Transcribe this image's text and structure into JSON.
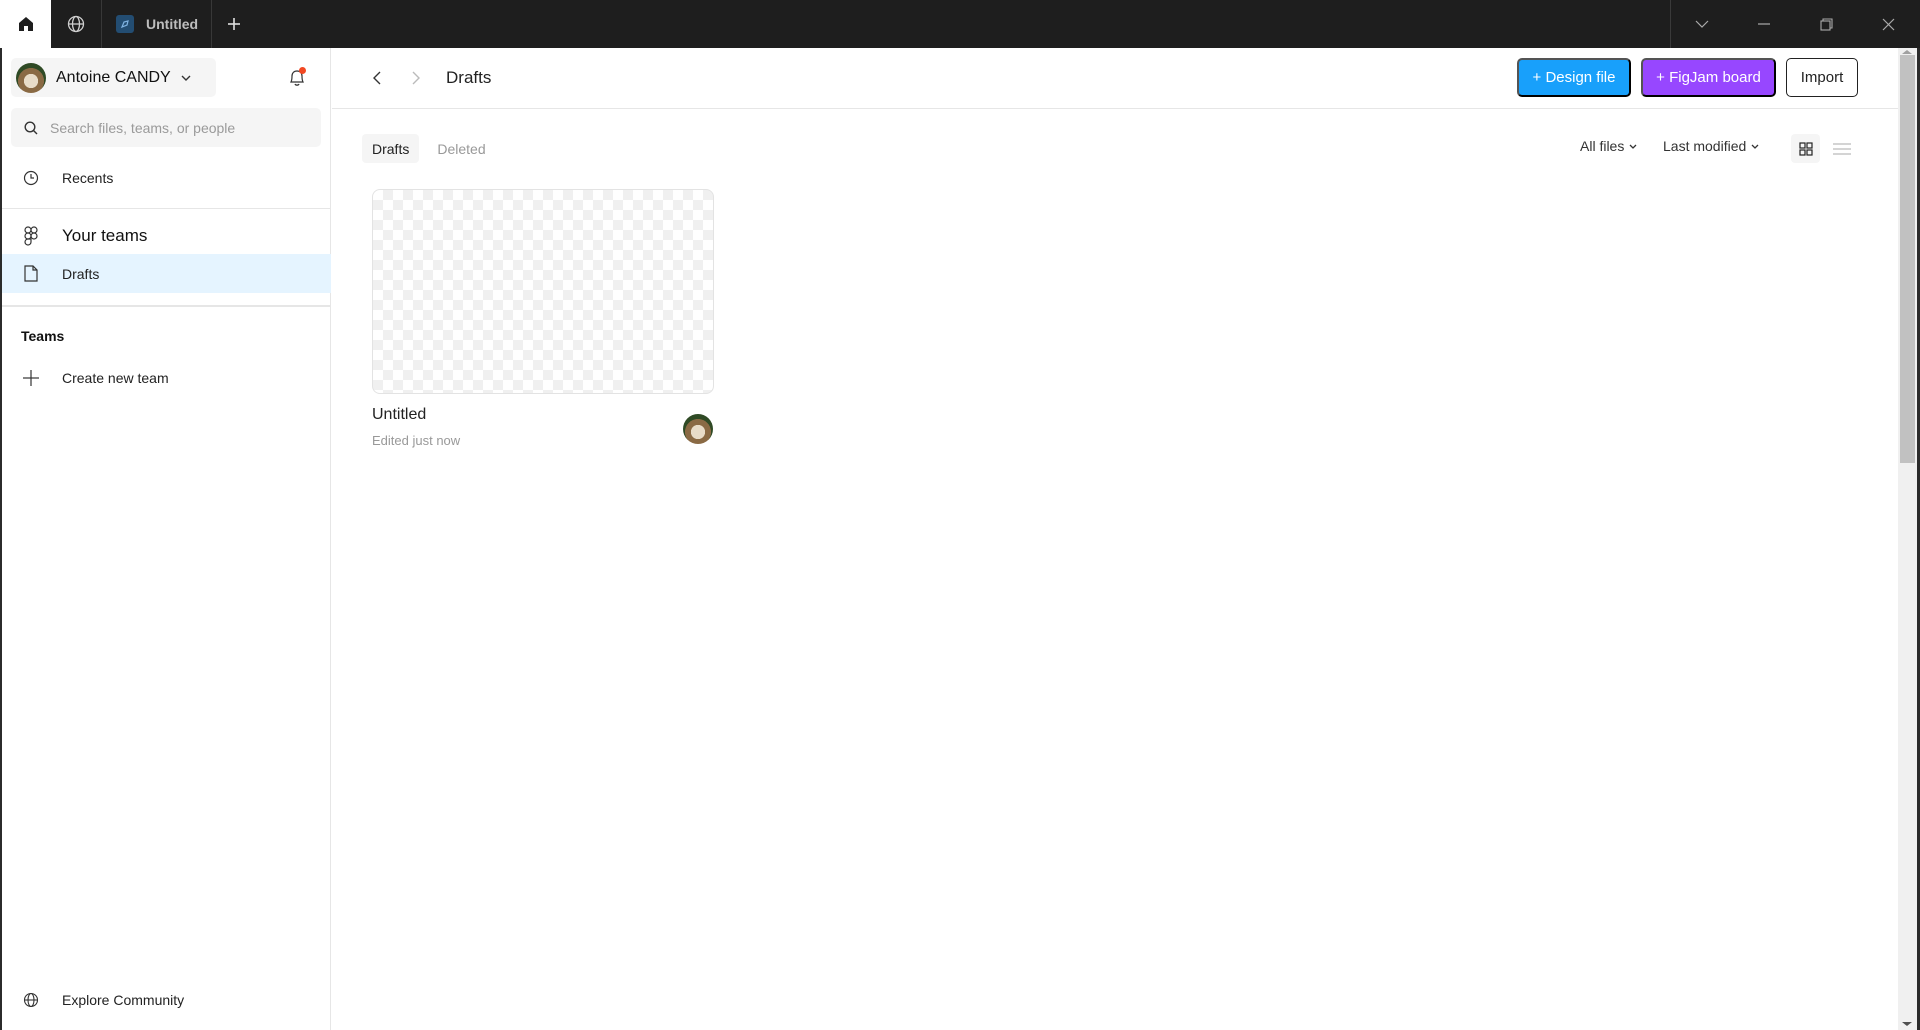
{
  "titlebar": {
    "tabs": [
      {
        "label": "",
        "icon": "home-icon"
      },
      {
        "label": "",
        "icon": "globe-icon"
      },
      {
        "label": "Untitled",
        "icon": "design-file-icon"
      }
    ],
    "new_tab_icon": "plus-icon",
    "window_controls": [
      "chevron-down-icon",
      "minimize-icon",
      "restore-icon",
      "close-icon"
    ]
  },
  "sidebar": {
    "account_name": "Antoine CANDY",
    "notification_dot_color": "#f24822",
    "search_placeholder": "Search files, teams, or people",
    "recents_label": "Recents",
    "your_teams_label": "Your teams",
    "drafts_label": "Drafts",
    "teams_heading": "Teams",
    "create_team_label": "Create new team",
    "explore_label": "Explore Community"
  },
  "header": {
    "breadcrumb": "Drafts",
    "design_file_label": "+ Design file",
    "figjam_label": "+ FigJam board",
    "import_label": "Import",
    "design_color": "#18a0fb",
    "figjam_color": "#9747ff"
  },
  "toolbar": {
    "tabs": [
      {
        "label": "Drafts",
        "active": true
      },
      {
        "label": "Deleted",
        "active": false
      }
    ],
    "filter_label": "All files",
    "sort_label": "Last modified",
    "view_mode": "grid"
  },
  "files": [
    {
      "title": "Untitled",
      "subtitle": "Edited just now"
    }
  ],
  "scrollbar": {
    "position_fraction": 0.0
  }
}
